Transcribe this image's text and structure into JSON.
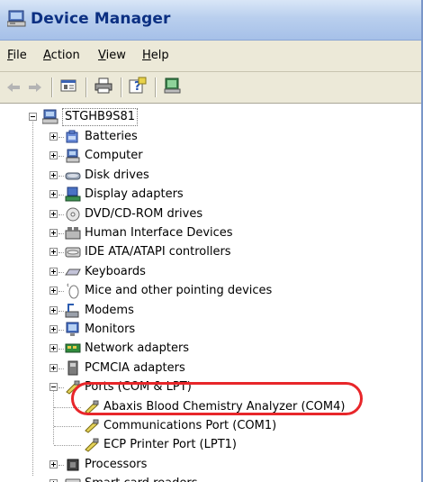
{
  "window": {
    "title": "Device Manager"
  },
  "menu": [
    {
      "label": "File",
      "accel": "F",
      "rest": "ile"
    },
    {
      "label": "Action",
      "accel": "A",
      "rest": "ction"
    },
    {
      "label": "View",
      "accel": "V",
      "rest": "iew"
    },
    {
      "label": "Help",
      "accel": "H",
      "rest": "elp"
    }
  ],
  "toolbar": {
    "buttons": [
      "back-arrow-icon",
      "forward-arrow-icon",
      "properties-icon",
      "print-icon",
      "help-icon",
      "scan-hardware-icon"
    ]
  },
  "tree": {
    "root": "STGHB9S81",
    "items": [
      {
        "label": "Batteries",
        "icon": "battery-icon"
      },
      {
        "label": "Computer",
        "icon": "computer-icon"
      },
      {
        "label": "Disk drives",
        "icon": "disk-drive-icon"
      },
      {
        "label": "Display adapters",
        "icon": "display-adapter-icon"
      },
      {
        "label": "DVD/CD-ROM drives",
        "icon": "dvd-drive-icon"
      },
      {
        "label": "Human Interface Devices",
        "icon": "hid-icon"
      },
      {
        "label": "IDE ATA/ATAPI controllers",
        "icon": "ide-controller-icon"
      },
      {
        "label": "Keyboards",
        "icon": "keyboard-icon"
      },
      {
        "label": "Mice and other pointing devices",
        "icon": "mouse-icon"
      },
      {
        "label": "Modems",
        "icon": "modem-icon"
      },
      {
        "label": "Monitors",
        "icon": "monitor-icon"
      },
      {
        "label": "Network adapters",
        "icon": "network-adapter-icon"
      },
      {
        "label": "PCMCIA adapters",
        "icon": "pcmcia-icon"
      },
      {
        "label": "Ports (COM & LPT)",
        "icon": "port-icon"
      }
    ],
    "ports_children": [
      {
        "label": "Abaxis Blood Chemistry Analyzer (COM4)",
        "icon": "port-icon"
      },
      {
        "label": "Communications Port (COM1)",
        "icon": "port-icon"
      },
      {
        "label": "ECP Printer Port (LPT1)",
        "icon": "port-icon"
      }
    ],
    "after": [
      {
        "label": "Processors",
        "icon": "processor-icon"
      },
      {
        "label": "Smart card readers",
        "icon": "smart-card-icon"
      }
    ]
  },
  "colors": {
    "title_text": "#0b2f82",
    "highlight": "#e8262a",
    "menu_bg": "#ece9d8"
  }
}
